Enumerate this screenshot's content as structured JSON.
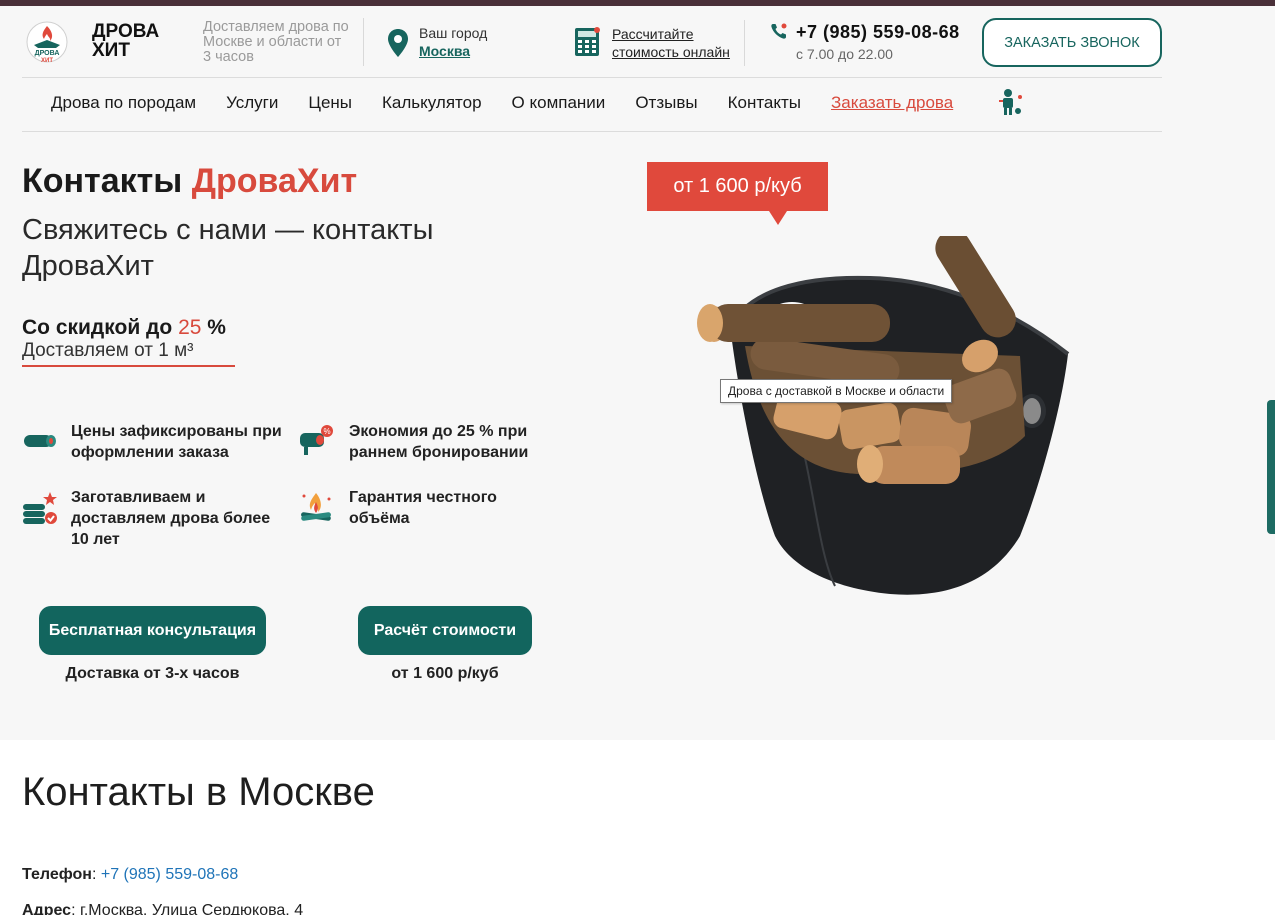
{
  "header": {
    "brand_line1": "ДРОВА",
    "brand_line2": "ХИТ",
    "logo_text_top": "ДРОВА",
    "logo_text_bottom": "ХИТ",
    "tagline": "Доставляем дрова по Москве и области от 3 часов",
    "city_label": "Ваш город",
    "city_name": "Москва",
    "calc_link": "Рассчитайте стоимость онлайн",
    "phone": "+7 (985) 559-08-68",
    "hours": "с 7.00 до 22.00",
    "callback_button": "ЗАКАЗАТЬ ЗВОНОК"
  },
  "nav": {
    "items": [
      "Дрова по породам",
      "Услуги",
      "Цены",
      "Калькулятор",
      "О компании",
      "Отзывы",
      "Контакты"
    ],
    "order": "Заказать дрова"
  },
  "hero": {
    "title_main": "Контакты ",
    "title_accent": "ДроваХит",
    "subtitle": "Свяжитесь с нами — контакты ДроваХит",
    "discount_prefix": "Со скидкой до ",
    "discount_value": "25",
    "discount_suffix": " %",
    "delivery_min": "Доставляем от 1 м³",
    "features": [
      {
        "icon": "log-icon",
        "text": "Цены зафиксированы при оформлении заказа"
      },
      {
        "icon": "discount-log-icon",
        "text": "Экономия до 25 % при раннем бронировании"
      },
      {
        "icon": "stacked-logs-check-icon",
        "text": "Заготавливаем и доставляем дрова более 10 лет"
      },
      {
        "icon": "campfire-icon",
        "text": "Гарантия честного объёма"
      }
    ],
    "buttons": [
      {
        "label": "Бесплатная консультация",
        "note": "Доставка от 3-х часов"
      },
      {
        "label": "Расчёт стоимости",
        "note": "от 1 600 р/куб"
      }
    ],
    "price_badge": "от 1 600 р/куб",
    "image_tooltip": "Дрова с доставкой в Москве и области"
  },
  "contacts": {
    "title": "Контакты в Москве",
    "phone_label": "Телефон",
    "phone_value": "+7 (985) 559-08-68",
    "address_label": "Адрес",
    "address_value": "г.Москва, Улица Сердюкова, 4"
  },
  "colors": {
    "accent_red": "#d84a3d",
    "brand_green": "#12655e",
    "top_bar": "#4a3039"
  }
}
